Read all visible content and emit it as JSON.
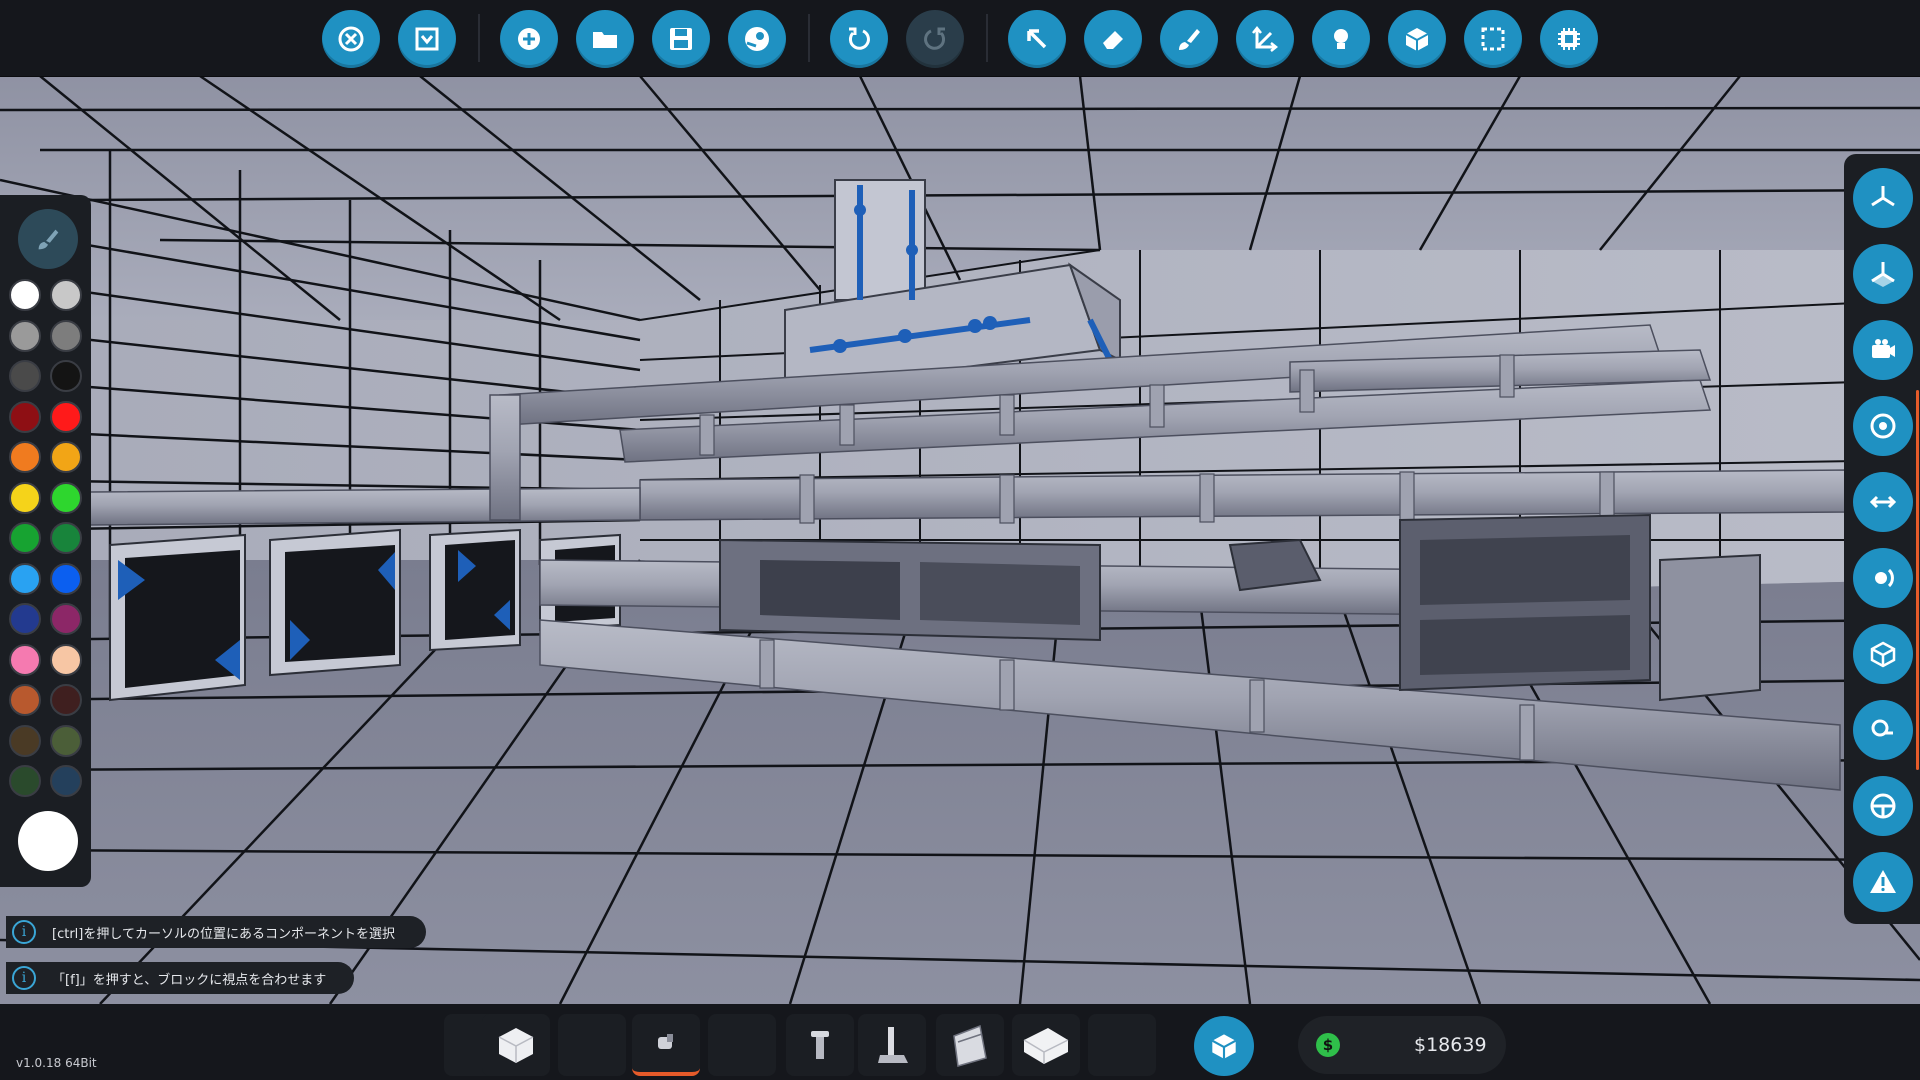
{
  "app": {
    "version": "v1.0.18 64Bit"
  },
  "colors": {
    "accent": "#1f91c2",
    "accent_disabled": "#2a3d4a",
    "panel": "#1b1e23",
    "active_indicator": "#e65b2a",
    "money_icon": "#2fbf4a"
  },
  "toolbar": {
    "buttons": [
      {
        "name": "close-editor",
        "icon": "close-x-icon"
      },
      {
        "name": "dropdown-menu",
        "icon": "chevron-down-icon"
      },
      {
        "name": "new-vehicle",
        "icon": "plus-icon"
      },
      {
        "name": "open-file",
        "icon": "folder-icon"
      },
      {
        "name": "save-file",
        "icon": "save-disk-icon"
      },
      {
        "name": "steam-workshop",
        "icon": "steam-icon"
      },
      {
        "name": "undo",
        "icon": "undo-icon"
      },
      {
        "name": "redo",
        "icon": "redo-icon",
        "disabled": true
      },
      {
        "name": "select-tool",
        "icon": "cursor-arrow-icon"
      },
      {
        "name": "erase-tool",
        "icon": "eraser-icon"
      },
      {
        "name": "paint-tool",
        "icon": "paintbrush-icon"
      },
      {
        "name": "move-tool",
        "icon": "move-axes-icon"
      },
      {
        "name": "lights-toggle",
        "icon": "lightbulb-icon"
      },
      {
        "name": "logic-view",
        "icon": "cube-network-icon"
      },
      {
        "name": "area-select",
        "icon": "dashed-selection-icon"
      },
      {
        "name": "microprocessor",
        "icon": "chip-icon"
      }
    ]
  },
  "palette": {
    "swatches": [
      [
        "#ffffff",
        "#c8c8c8"
      ],
      [
        "#9a9a9a",
        "#7d7d7d"
      ],
      [
        "#4a4a4a",
        "#141414"
      ],
      [
        "#8e0f14",
        "#ff1a1a"
      ],
      [
        "#f07b1f",
        "#f2a516"
      ],
      [
        "#f5d31a",
        "#2ed62e"
      ],
      [
        "#17a331",
        "#18843b"
      ],
      [
        "#29a2f2",
        "#0b5ff0"
      ],
      [
        "#233a8f",
        "#8c2767"
      ],
      [
        "#f57ab0",
        "#f7c6a4"
      ],
      [
        "#b8592e",
        "#3f1f1f"
      ],
      [
        "#4a3a25",
        "#4b5e38"
      ],
      [
        "#2a4a2c",
        "#24405c"
      ]
    ],
    "selected_color": "#ffffff"
  },
  "sidebar_right": {
    "buttons": [
      {
        "name": "view-axes",
        "icon": "axes-icon"
      },
      {
        "name": "view-axes-2",
        "icon": "axes-plane-icon"
      },
      {
        "name": "camera",
        "icon": "camera-icon"
      },
      {
        "name": "center-view",
        "icon": "target-icon"
      },
      {
        "name": "mirror",
        "icon": "mirror-arrows-icon"
      },
      {
        "name": "rotate-view",
        "icon": "rotate-view-icon"
      },
      {
        "name": "block-view",
        "icon": "box-icon"
      },
      {
        "name": "search-inspect",
        "icon": "magnify-icon"
      },
      {
        "name": "seat-view",
        "icon": "steering-wheel-icon"
      },
      {
        "name": "warnings",
        "icon": "warning-triangle-icon"
      }
    ]
  },
  "hints": [
    "[ctrl]を押してカーソルの位置にあるコンポーネントを選択",
    "「[f]」を押すと、ブロックに視点を合わせます"
  ],
  "hotbar": {
    "slots": [
      {
        "icon": "",
        "active": false
      },
      {
        "icon": "white-block-icon",
        "active": false
      },
      {
        "icon": "",
        "active": false
      },
      {
        "icon": "small-part-icon",
        "active": true
      },
      {
        "icon": "",
        "active": false
      },
      {
        "icon": "pipe-part-icon",
        "active": false
      },
      {
        "icon": "lever-icon",
        "active": false
      },
      {
        "icon": "wedge-block-icon",
        "active": false
      },
      {
        "icon": "white-slope-block-icon",
        "active": false
      },
      {
        "icon": "",
        "active": false
      }
    ]
  },
  "money": {
    "amount": "$18639",
    "icon": "money-icon"
  }
}
